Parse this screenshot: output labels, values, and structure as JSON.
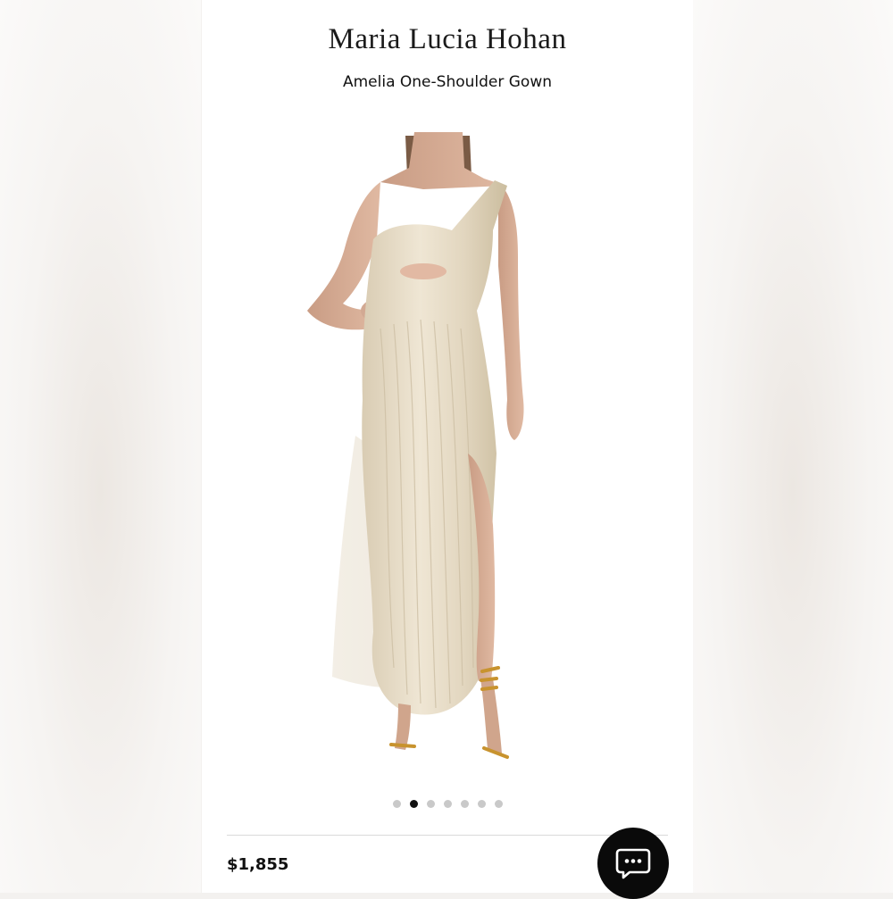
{
  "product": {
    "brand": "Maria Lucia Hohan",
    "name": "Amelia One-Shoulder Gown",
    "price": "$1,855"
  },
  "gallery": {
    "total_images": 7,
    "active_index": 1
  },
  "chat": {
    "icon": "chat-bubble-icon"
  },
  "colors": {
    "gown": "#e7dcc6",
    "sandals": "#c8932e",
    "accent": "#0a0a0a"
  }
}
